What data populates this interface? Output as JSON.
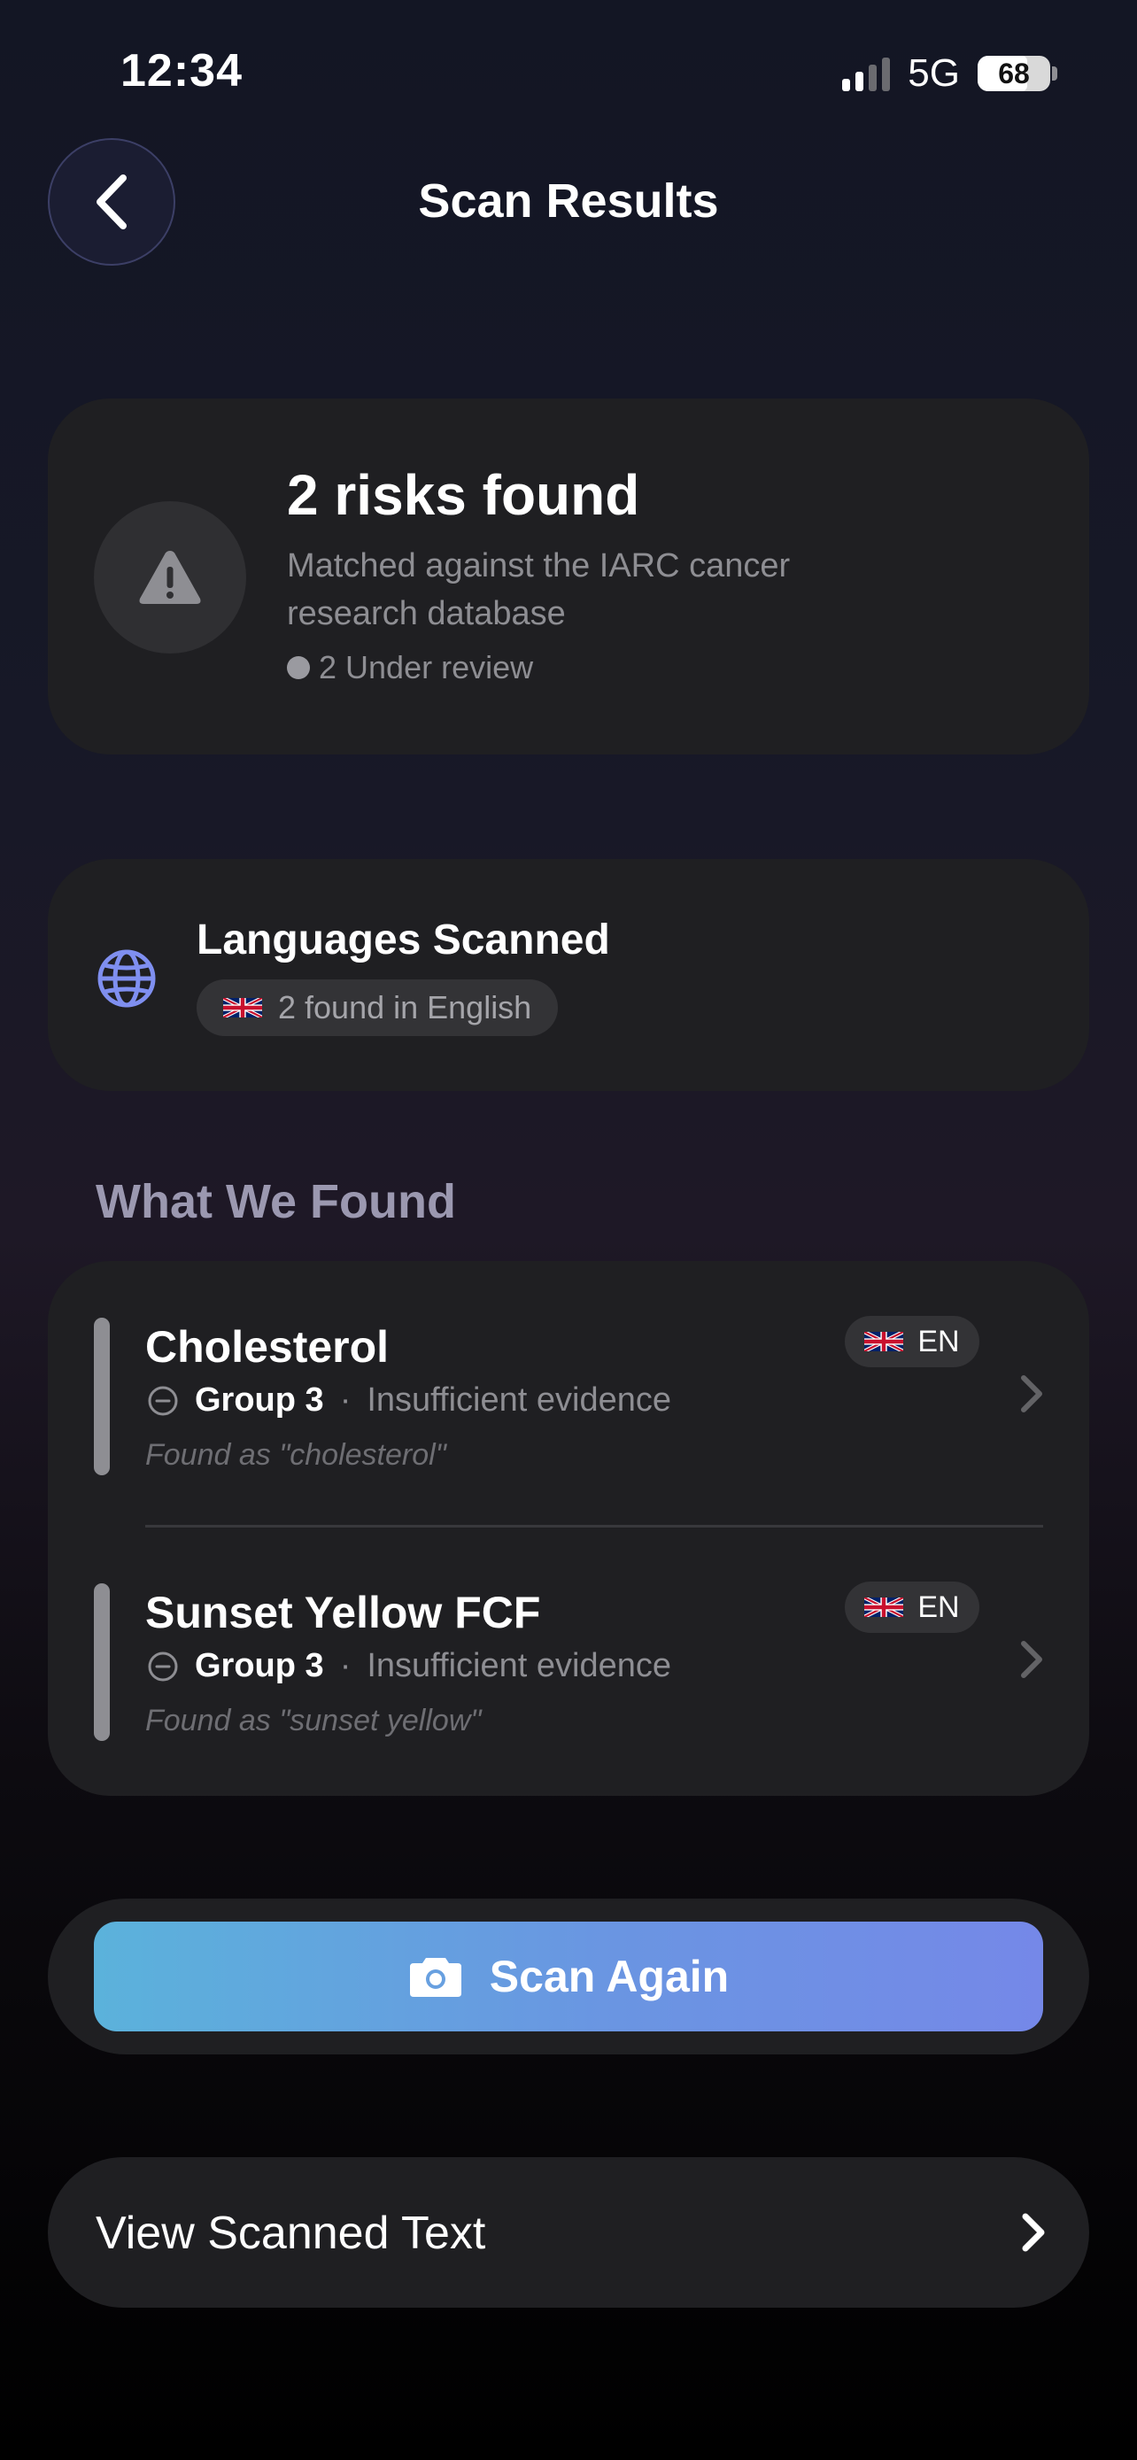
{
  "status_bar": {
    "time": "12:34",
    "network": "5G",
    "battery": "68"
  },
  "header": {
    "title": "Scan Results",
    "back_icon": "chevron-left-icon"
  },
  "summary": {
    "title": "2 risks found",
    "subtitle": "Matched against the IARC cancer research database",
    "review_status": "2 Under review",
    "icon": "warning-icon"
  },
  "languages": {
    "title": "Languages Scanned",
    "pill_text": "2 found in English",
    "icon": "globe-icon",
    "flag": "uk-flag-icon"
  },
  "found_section": {
    "title": "What We Found",
    "items": [
      {
        "name": "Cholesterol",
        "group": "Group 3",
        "evidence": "Insufficient evidence",
        "found_as": "Found as \"cholesterol\"",
        "language": "EN"
      },
      {
        "name": "Sunset Yellow FCF",
        "group": "Group 3",
        "evidence": "Insufficient evidence",
        "found_as": "Found as \"sunset yellow\"",
        "language": "EN"
      }
    ]
  },
  "actions": {
    "scan_again": "Scan Again",
    "view_scanned_text": "View Scanned Text"
  },
  "colors": {
    "accent_start": "#5bb2db",
    "accent_end": "#7588e8",
    "card": "#1f1f22",
    "muted": "#8e8e93"
  }
}
